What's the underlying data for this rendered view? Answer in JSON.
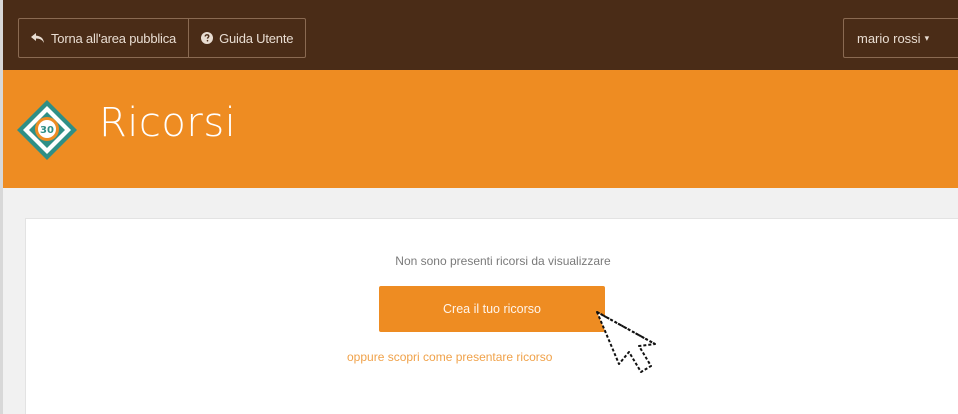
{
  "topbar": {
    "back_label": "Torna all'area pubblica",
    "guide_label": "Guida Utente",
    "user_label": "mario rossi",
    "user_caret": "▾"
  },
  "header": {
    "title": "Ricorsi",
    "logo_icon": "diamond-number-logo-icon"
  },
  "main": {
    "empty_message": "Non sono presenti ricorsi da visualizzare",
    "create_button": "Crea il tuo ricorso",
    "learn_link": "oppure scopri come presentare ricorso"
  },
  "colors": {
    "topbar": "#4a2c17",
    "header": "#ee8c22",
    "accent": "#ee8c22",
    "link": "#f0a24a"
  }
}
